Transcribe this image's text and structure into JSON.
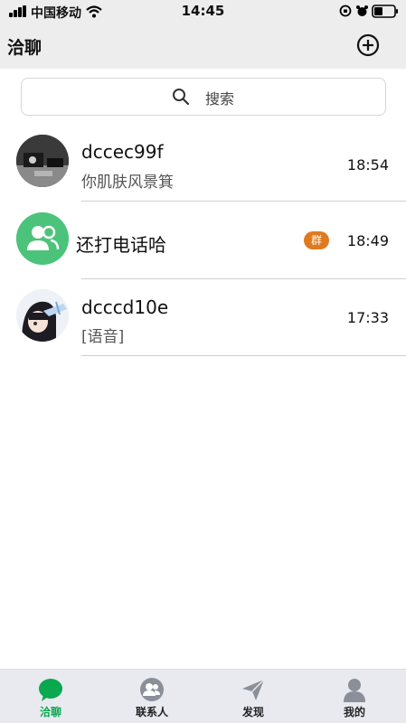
{
  "status_bar": {
    "carrier": "中国移动",
    "time": "14:45"
  },
  "nav": {
    "title": "洽聊"
  },
  "search": {
    "placeholder": "搜索"
  },
  "chats": [
    {
      "name": "dccec99f",
      "message": "你肌肤风景箕",
      "time": "18:54",
      "avatar": "photo-avatar"
    },
    {
      "name": "还打电话哈",
      "badge": "群",
      "time": "18:49",
      "avatar": "group-avatar"
    },
    {
      "name": "dcccd10e",
      "message": "[语音]",
      "time": "17:33",
      "avatar": "anime-avatar"
    }
  ],
  "tabs": [
    {
      "label": "洽聊",
      "icon": "chat-icon",
      "active": true
    },
    {
      "label": "联系人",
      "icon": "contacts-icon",
      "active": false
    },
    {
      "label": "发现",
      "icon": "discover-icon",
      "active": false
    },
    {
      "label": "我的",
      "icon": "profile-icon",
      "active": false
    }
  ],
  "colors": {
    "accent": "#0aa84f",
    "group_avatar": "#4cc37a",
    "badge": "#e07a1f"
  }
}
